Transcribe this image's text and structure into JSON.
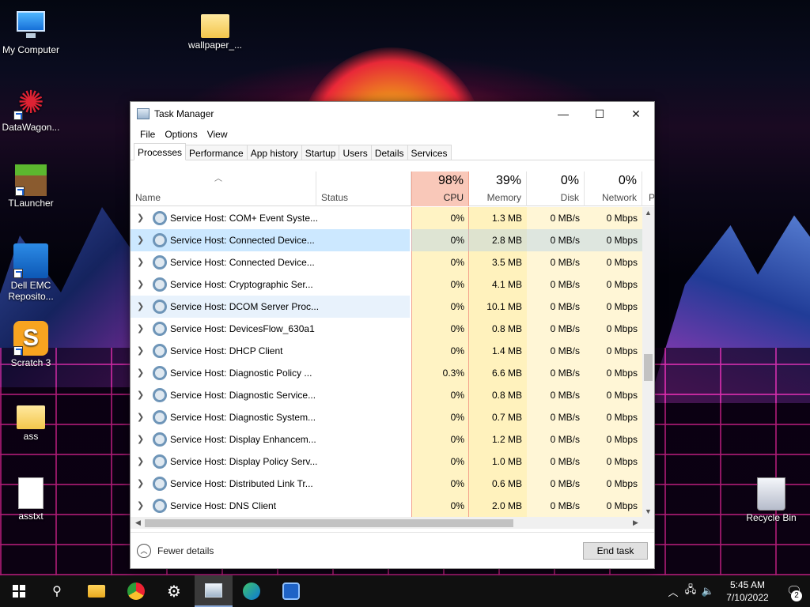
{
  "desktop": {
    "icons": [
      {
        "label": "My Computer"
      },
      {
        "label": "wallpaper_..."
      },
      {
        "label": "DataWagon..."
      },
      {
        "label": "TLauncher"
      },
      {
        "label": "Dell EMC Reposito..."
      },
      {
        "label": "Scratch 3"
      },
      {
        "label": "ass"
      },
      {
        "label": "asstxt"
      },
      {
        "label": "Recycle Bin"
      }
    ]
  },
  "window": {
    "title": "Task Manager",
    "controls": {
      "minimize": "—",
      "maximize": "☐",
      "close": "✕"
    }
  },
  "menu": [
    "File",
    "Options",
    "View"
  ],
  "tabs": [
    "Processes",
    "Performance",
    "App history",
    "Startup",
    "Users",
    "Details",
    "Services"
  ],
  "columns": {
    "name": "Name",
    "status": "Status",
    "cpu": {
      "pct": "98%",
      "label": "CPU"
    },
    "memory": {
      "pct": "39%",
      "label": "Memory"
    },
    "disk": {
      "pct": "0%",
      "label": "Disk"
    },
    "network": {
      "pct": "0%",
      "label": "Network"
    },
    "power": "P"
  },
  "rows": [
    {
      "name": "Service Host: COM+ Event Syste...",
      "cpu": "0%",
      "memory": "1.3 MB",
      "disk": "0 MB/s",
      "network": "0 Mbps"
    },
    {
      "name": "Service Host: Connected Device...",
      "cpu": "0%",
      "memory": "2.8 MB",
      "disk": "0 MB/s",
      "network": "0 Mbps"
    },
    {
      "name": "Service Host: Connected Device...",
      "cpu": "0%",
      "memory": "3.5 MB",
      "disk": "0 MB/s",
      "network": "0 Mbps"
    },
    {
      "name": "Service Host: Cryptographic Ser...",
      "cpu": "0%",
      "memory": "4.1 MB",
      "disk": "0 MB/s",
      "network": "0 Mbps"
    },
    {
      "name": "Service Host: DCOM Server Proc...",
      "cpu": "0%",
      "memory": "10.1 MB",
      "disk": "0 MB/s",
      "network": "0 Mbps"
    },
    {
      "name": "Service Host: DevicesFlow_630a1",
      "cpu": "0%",
      "memory": "0.8 MB",
      "disk": "0 MB/s",
      "network": "0 Mbps"
    },
    {
      "name": "Service Host: DHCP Client",
      "cpu": "0%",
      "memory": "1.4 MB",
      "disk": "0 MB/s",
      "network": "0 Mbps"
    },
    {
      "name": "Service Host: Diagnostic Policy ...",
      "cpu": "0.3%",
      "memory": "6.6 MB",
      "disk": "0 MB/s",
      "network": "0 Mbps"
    },
    {
      "name": "Service Host: Diagnostic Service...",
      "cpu": "0%",
      "memory": "0.8 MB",
      "disk": "0 MB/s",
      "network": "0 Mbps"
    },
    {
      "name": "Service Host: Diagnostic System...",
      "cpu": "0%",
      "memory": "0.7 MB",
      "disk": "0 MB/s",
      "network": "0 Mbps"
    },
    {
      "name": "Service Host: Display Enhancem...",
      "cpu": "0%",
      "memory": "1.2 MB",
      "disk": "0 MB/s",
      "network": "0 Mbps"
    },
    {
      "name": "Service Host: Display Policy Serv...",
      "cpu": "0%",
      "memory": "1.0 MB",
      "disk": "0 MB/s",
      "network": "0 Mbps"
    },
    {
      "name": "Service Host: Distributed Link Tr...",
      "cpu": "0%",
      "memory": "0.6 MB",
      "disk": "0 MB/s",
      "network": "0 Mbps"
    },
    {
      "name": "Service Host: DNS Client",
      "cpu": "0%",
      "memory": "2.0 MB",
      "disk": "0 MB/s",
      "network": "0 Mbps"
    }
  ],
  "footer": {
    "fewer_details": "Fewer details",
    "end_task": "End task"
  },
  "taskbar": {
    "time": "5:45 AM",
    "date": "7/10/2022",
    "notification_count": "2"
  },
  "colors": {
    "cpu_header": "#f9c8b9",
    "cpu_column": "#fff3c4",
    "selection": "#cce8ff"
  }
}
